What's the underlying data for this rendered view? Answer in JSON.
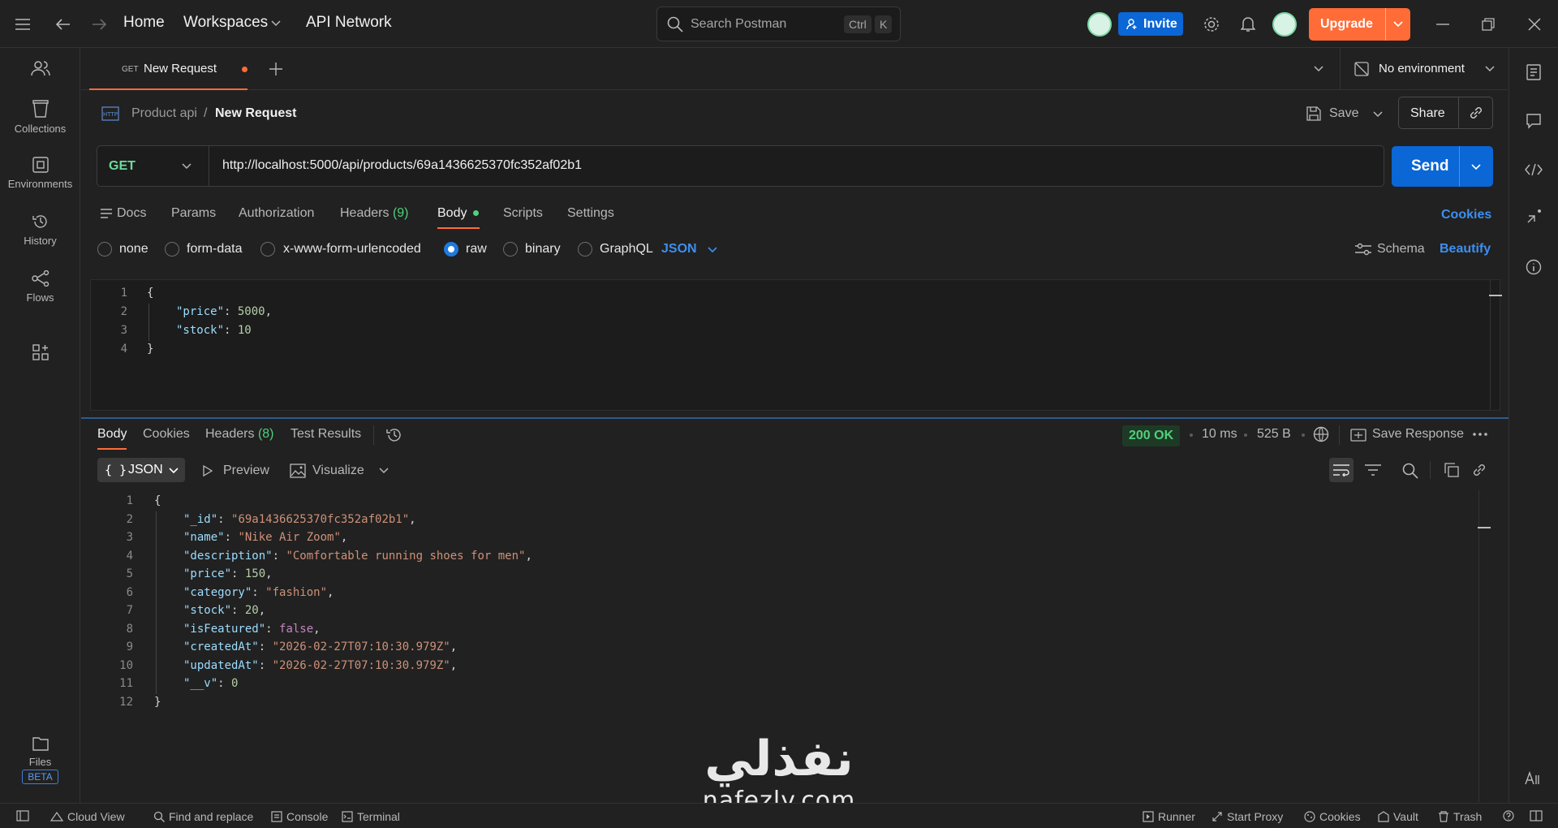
{
  "topbar": {
    "nav_home": "Home",
    "nav_workspaces": "Workspaces",
    "nav_api_network": "API Network",
    "search_placeholder": "Search Postman",
    "search_kbd_ctrl": "Ctrl",
    "search_kbd_k": "K",
    "invite_label": "Invite",
    "upgrade_label": "Upgrade"
  },
  "sidebar": {
    "items": [
      {
        "label": "Collections",
        "icon": "collections-icon"
      },
      {
        "label": "Environments",
        "icon": "environments-icon"
      },
      {
        "label": "History",
        "icon": "history-icon"
      },
      {
        "label": "Flows",
        "icon": "flows-icon"
      }
    ],
    "files_label": "Files",
    "files_badge": "BETA"
  },
  "tab": {
    "method": "GET",
    "title": "New Request",
    "environment": "No environment"
  },
  "breadcrumb": {
    "collection": "Product api",
    "separator": "/",
    "request": "New Request",
    "save_label": "Save",
    "share_label": "Share"
  },
  "request": {
    "method": "GET",
    "url": "http://localhost:5000/api/products/69a1436625370fc352af02b1",
    "send_label": "Send",
    "tabs": {
      "docs": "Docs",
      "params": "Params",
      "authorization": "Authorization",
      "headers": "Headers",
      "headers_count": "(9)",
      "body": "Body",
      "scripts": "Scripts",
      "settings": "Settings",
      "cookies": "Cookies"
    },
    "body_types": {
      "none": "none",
      "form_data": "form-data",
      "urlencoded": "x-www-form-urlencoded",
      "raw": "raw",
      "binary": "binary",
      "graphql": "GraphQL",
      "format": "JSON",
      "schema": "Schema",
      "beautify": "Beautify"
    },
    "body_lines": [
      {
        "n": "1",
        "indent": 0,
        "tokens": [
          {
            "t": "{",
            "c": "p"
          }
        ]
      },
      {
        "n": "2",
        "indent": 1,
        "tokens": [
          {
            "t": "\"price\"",
            "c": "k"
          },
          {
            "t": ": ",
            "c": "p"
          },
          {
            "t": "5000",
            "c": "n"
          },
          {
            "t": ",",
            "c": "p"
          }
        ]
      },
      {
        "n": "3",
        "indent": 1,
        "tokens": [
          {
            "t": "\"stock\"",
            "c": "k"
          },
          {
            "t": ": ",
            "c": "p"
          },
          {
            "t": "10",
            "c": "n"
          }
        ]
      },
      {
        "n": "4",
        "indent": 0,
        "tokens": [
          {
            "t": "}",
            "c": "p"
          }
        ]
      }
    ]
  },
  "response": {
    "tabs": {
      "body": "Body",
      "cookies": "Cookies",
      "headers": "Headers",
      "headers_count": "(8)",
      "test_results": "Test Results"
    },
    "status": "200 OK",
    "time": "10 ms",
    "size": "525 B",
    "save_response": "Save Response",
    "format": "JSON",
    "preview": "Preview",
    "visualize": "Visualize",
    "body_lines": [
      {
        "n": "1",
        "indent": 0,
        "tokens": [
          {
            "t": "{",
            "c": "p"
          }
        ]
      },
      {
        "n": "2",
        "indent": 1,
        "tokens": [
          {
            "t": "\"_id\"",
            "c": "kr"
          },
          {
            "t": ": ",
            "c": "p"
          },
          {
            "t": "\"69a1436625370fc352af02b1\"",
            "c": "s"
          },
          {
            "t": ",",
            "c": "p"
          }
        ]
      },
      {
        "n": "3",
        "indent": 1,
        "tokens": [
          {
            "t": "\"name\"",
            "c": "kr"
          },
          {
            "t": ": ",
            "c": "p"
          },
          {
            "t": "\"Nike Air Zoom\"",
            "c": "s"
          },
          {
            "t": ",",
            "c": "p"
          }
        ]
      },
      {
        "n": "4",
        "indent": 1,
        "tokens": [
          {
            "t": "\"description\"",
            "c": "kr"
          },
          {
            "t": ": ",
            "c": "p"
          },
          {
            "t": "\"Comfortable running shoes for men\"",
            "c": "s"
          },
          {
            "t": ",",
            "c": "p"
          }
        ]
      },
      {
        "n": "5",
        "indent": 1,
        "tokens": [
          {
            "t": "\"price\"",
            "c": "kr"
          },
          {
            "t": ": ",
            "c": "p"
          },
          {
            "t": "150",
            "c": "n"
          },
          {
            "t": ",",
            "c": "p"
          }
        ]
      },
      {
        "n": "6",
        "indent": 1,
        "tokens": [
          {
            "t": "\"category\"",
            "c": "kr"
          },
          {
            "t": ": ",
            "c": "p"
          },
          {
            "t": "\"fashion\"",
            "c": "s"
          },
          {
            "t": ",",
            "c": "p"
          }
        ]
      },
      {
        "n": "7",
        "indent": 1,
        "tokens": [
          {
            "t": "\"stock\"",
            "c": "kr"
          },
          {
            "t": ": ",
            "c": "p"
          },
          {
            "t": "20",
            "c": "n"
          },
          {
            "t": ",",
            "c": "p"
          }
        ]
      },
      {
        "n": "8",
        "indent": 1,
        "tokens": [
          {
            "t": "\"isFeatured\"",
            "c": "kr"
          },
          {
            "t": ": ",
            "c": "p"
          },
          {
            "t": "false",
            "c": "kw"
          },
          {
            "t": ",",
            "c": "p"
          }
        ]
      },
      {
        "n": "9",
        "indent": 1,
        "tokens": [
          {
            "t": "\"createdAt\"",
            "c": "kr"
          },
          {
            "t": ": ",
            "c": "p"
          },
          {
            "t": "\"2026-02-27T07:10:30.979Z\"",
            "c": "s"
          },
          {
            "t": ",",
            "c": "p"
          }
        ]
      },
      {
        "n": "10",
        "indent": 1,
        "tokens": [
          {
            "t": "\"updatedAt\"",
            "c": "kr"
          },
          {
            "t": ": ",
            "c": "p"
          },
          {
            "t": "\"2026-02-27T07:10:30.979Z\"",
            "c": "s"
          },
          {
            "t": ",",
            "c": "p"
          }
        ]
      },
      {
        "n": "11",
        "indent": 1,
        "tokens": [
          {
            "t": "\"__v\"",
            "c": "kr"
          },
          {
            "t": ": ",
            "c": "p"
          },
          {
            "t": "0",
            "c": "n"
          }
        ]
      },
      {
        "n": "12",
        "indent": 0,
        "tokens": [
          {
            "t": "}",
            "c": "p"
          }
        ]
      }
    ]
  },
  "footer": {
    "cloud_view": "Cloud View",
    "find_replace": "Find and replace",
    "console": "Console",
    "terminal": "Terminal",
    "runner": "Runner",
    "start_proxy": "Start Proxy",
    "cookies": "Cookies",
    "vault": "Vault",
    "trash": "Trash"
  },
  "watermark": {
    "arabic": "نفذلي",
    "latin": "nafezly.com"
  },
  "colors": {
    "accent_orange": "#ff6c37",
    "primary_blue": "#0b66d6",
    "status_green": "#4fd07a",
    "get_green": "#6bdd9a"
  }
}
